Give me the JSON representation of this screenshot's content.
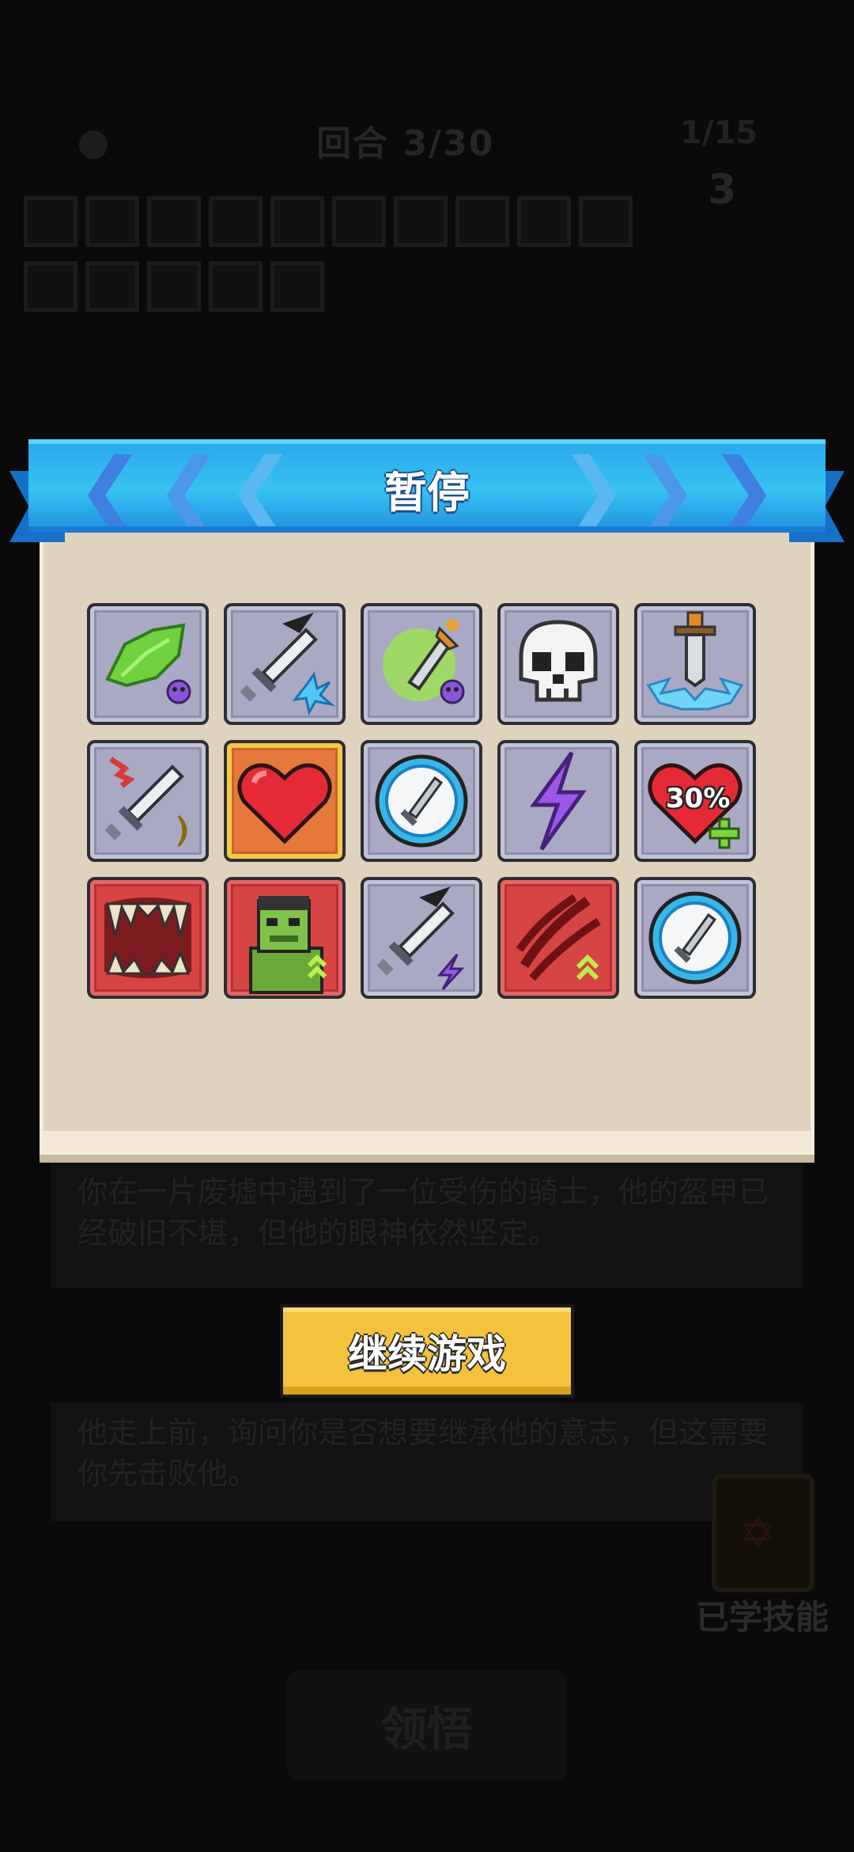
{
  "background": {
    "round_text": "回合 3/30",
    "corner_stat": "1/15",
    "corner_number": "3",
    "story_text_1": "你在一片废墟中遇到了一位受伤的骑士，他的盔甲已经破旧不堪，但他的眼神依然坚定。",
    "story_text_2": "他走上前，询问你是否想要继承他的意志，但这需要你先击败他。",
    "learned_skills_label": "已学技能",
    "bottom_button_label": "领悟",
    "scroll_icon": "hexagram-scroll-icon"
  },
  "modal": {
    "title": "暂停",
    "continue_label": "继续游戏",
    "ribbon_color": "#2bb6ee",
    "paper_color": "#e0d3be",
    "button_color": "#f4c23c"
  },
  "skills": [
    {
      "name": "poison-leaf-skill-icon",
      "frame": "gray"
    },
    {
      "name": "frost-sword-skill-icon",
      "frame": "gray"
    },
    {
      "name": "poison-dagger-skill-icon",
      "frame": "gray"
    },
    {
      "name": "skull-skill-icon",
      "frame": "gray"
    },
    {
      "name": "sword-splash-skill-icon",
      "frame": "gray"
    },
    {
      "name": "crescent-sword-skill-icon",
      "frame": "gray"
    },
    {
      "name": "heart-skill-icon",
      "frame": "gold"
    },
    {
      "name": "shield-sword-orb-skill-icon",
      "frame": "gray"
    },
    {
      "name": "lightning-skill-icon",
      "frame": "gray"
    },
    {
      "name": "heal-heart-skill-icon",
      "frame": "gray",
      "label": "30%"
    },
    {
      "name": "fangs-skill-icon",
      "frame": "red"
    },
    {
      "name": "orc-brute-skill-icon",
      "frame": "red"
    },
    {
      "name": "thunder-sword-skill-icon",
      "frame": "gray"
    },
    {
      "name": "claw-slash-skill-icon",
      "frame": "red"
    },
    {
      "name": "shield-sword-orb-skill-icon-2",
      "frame": "gray"
    }
  ]
}
